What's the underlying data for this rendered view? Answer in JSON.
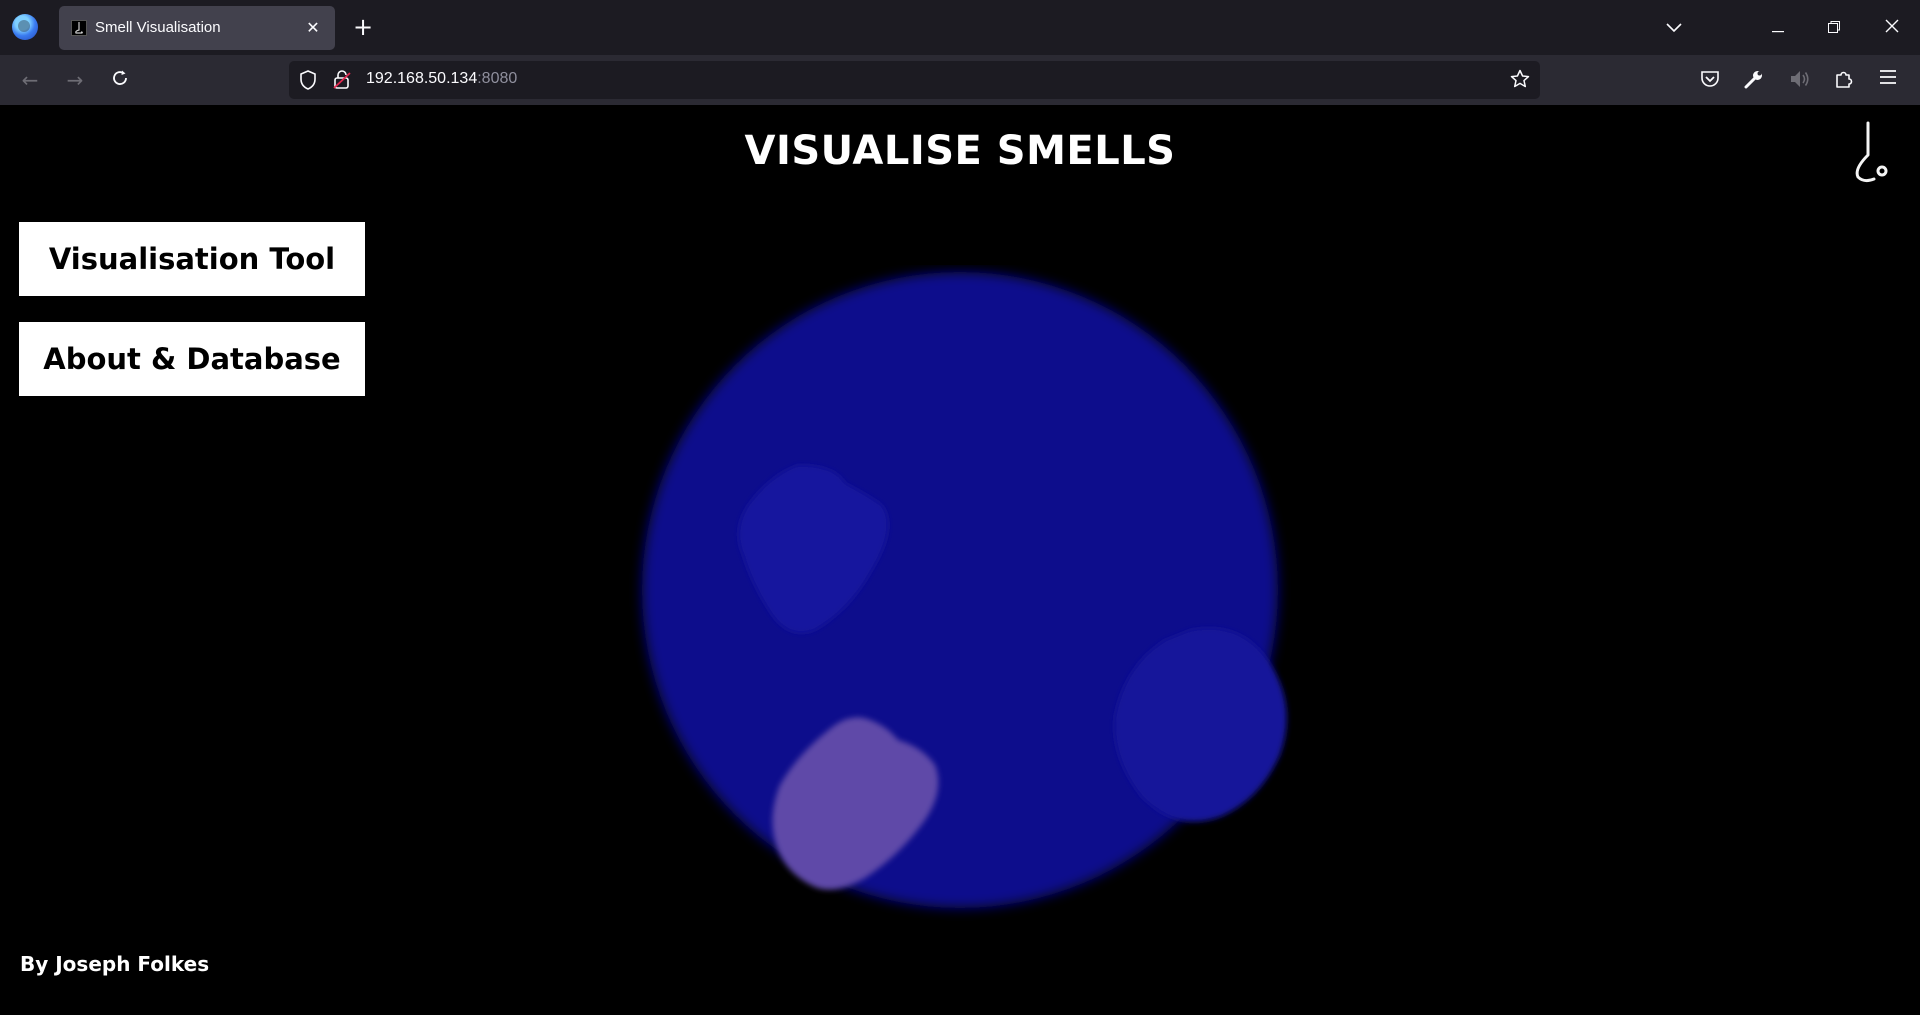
{
  "browser": {
    "tab_title": "Smell Visualisation",
    "url_host": "192.168.50.134",
    "url_port": ":8080"
  },
  "page": {
    "title": "VISUALISE SMELLS",
    "buttons": {
      "visualisation_tool": "Visualisation Tool",
      "about_database": "About & Database"
    },
    "author": "By Joseph Folkes"
  },
  "icons": {
    "logo": "nose-icon",
    "browser": "firefox-icon"
  },
  "colors": {
    "orb": "#0a0a8c",
    "blob_light": "#5f4aa8",
    "blob_dark": "#16169e",
    "background": "#000000"
  }
}
